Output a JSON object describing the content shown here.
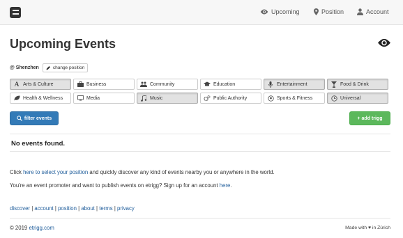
{
  "nav": {
    "upcoming": "Upcoming",
    "position": "Position",
    "account": "Account"
  },
  "page": {
    "title": "Upcoming Events",
    "location_city": "@ Shenzhen",
    "change_position": "change position"
  },
  "categories": [
    {
      "label": "Arts & Culture",
      "icon": "font-icon",
      "active": true
    },
    {
      "label": "Business",
      "icon": "briefcase-icon",
      "active": false
    },
    {
      "label": "Community",
      "icon": "users-icon",
      "active": false
    },
    {
      "label": "Education",
      "icon": "graduation-cap-icon",
      "active": false
    },
    {
      "label": "Entertainment",
      "icon": "microphone-icon",
      "active": true
    },
    {
      "label": "Food & Drink",
      "icon": "glass-icon",
      "active": true
    },
    {
      "label": "Health & Wellness",
      "icon": "leaf-icon",
      "active": false
    },
    {
      "label": "Media",
      "icon": "monitor-icon",
      "active": false
    },
    {
      "label": "Music",
      "icon": "music-icon",
      "active": true
    },
    {
      "label": "Public Authority",
      "icon": "cogs-icon",
      "active": false
    },
    {
      "label": "Sports & Fitness",
      "icon": "soccer-ball-icon",
      "active": false
    },
    {
      "label": "Universal",
      "icon": "clock-icon",
      "active": true
    }
  ],
  "buttons": {
    "filter": "filter events",
    "add": "+ add trigg"
  },
  "no_events": "No events found.",
  "info": {
    "line1_pre": "Click ",
    "line1_link": "here to select your position",
    "line1_post": " and quickly discover any kind of events nearby you or anywhere in the world.",
    "line2_pre": "You're an event promoter and want to publish events on etrigg? Sign up for an account ",
    "line2_link": "here",
    "line2_post": "."
  },
  "footer": {
    "links": [
      "discover",
      "account",
      "position",
      "about",
      "terms",
      "privacy"
    ],
    "separator": " | ",
    "copyright_pre": "© 2019 ",
    "copyright_link": "etrigg.com",
    "made_with_pre": "Made with ",
    "made_with_heart": "♥",
    "made_with_post": " in Zürich"
  },
  "colors": {
    "primary": "#337ab7",
    "success": "#5cb85c",
    "link": "#1f5d9b",
    "active_category": "#e2e2e2"
  }
}
